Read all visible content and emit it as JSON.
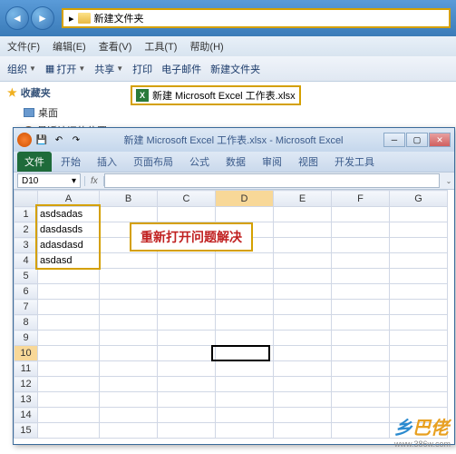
{
  "explorer": {
    "address_label": "新建文件夹",
    "menu": [
      "文件(F)",
      "编辑(E)",
      "查看(V)",
      "工具(T)",
      "帮助(H)"
    ],
    "toolbar": {
      "organize": "组织",
      "open": "打开",
      "share": "共享",
      "print": "打印",
      "email": "电子邮件",
      "new_folder": "新建文件夹"
    },
    "favorites": {
      "title": "收藏夹",
      "desktop": "桌面",
      "recent": "最近访问的位置"
    },
    "selected_file": "新建 Microsoft Excel 工作表.xlsx"
  },
  "excel": {
    "title": "新建 Microsoft Excel 工作表.xlsx - Microsoft Excel",
    "tabs": {
      "file": "文件",
      "home": "开始",
      "insert": "插入",
      "layout": "页面布局",
      "formula": "公式",
      "data": "数据",
      "review": "审阅",
      "view": "视图",
      "dev": "开发工具"
    },
    "name_box": "D10",
    "fx": "fx",
    "columns": [
      "A",
      "B",
      "C",
      "D",
      "E",
      "F",
      "G"
    ],
    "rows": [
      "1",
      "2",
      "3",
      "4",
      "5",
      "6",
      "7",
      "8",
      "9",
      "10",
      "11",
      "12",
      "13",
      "14",
      "15"
    ],
    "cell_data": {
      "A1": "asdsadas",
      "A2": "dasdasds",
      "A3": "adasdasd",
      "A4": "asdasd"
    },
    "note": "重新打开问题解决"
  },
  "watermark": {
    "brand": "乡巴佬",
    "url": "www.386w.com"
  }
}
